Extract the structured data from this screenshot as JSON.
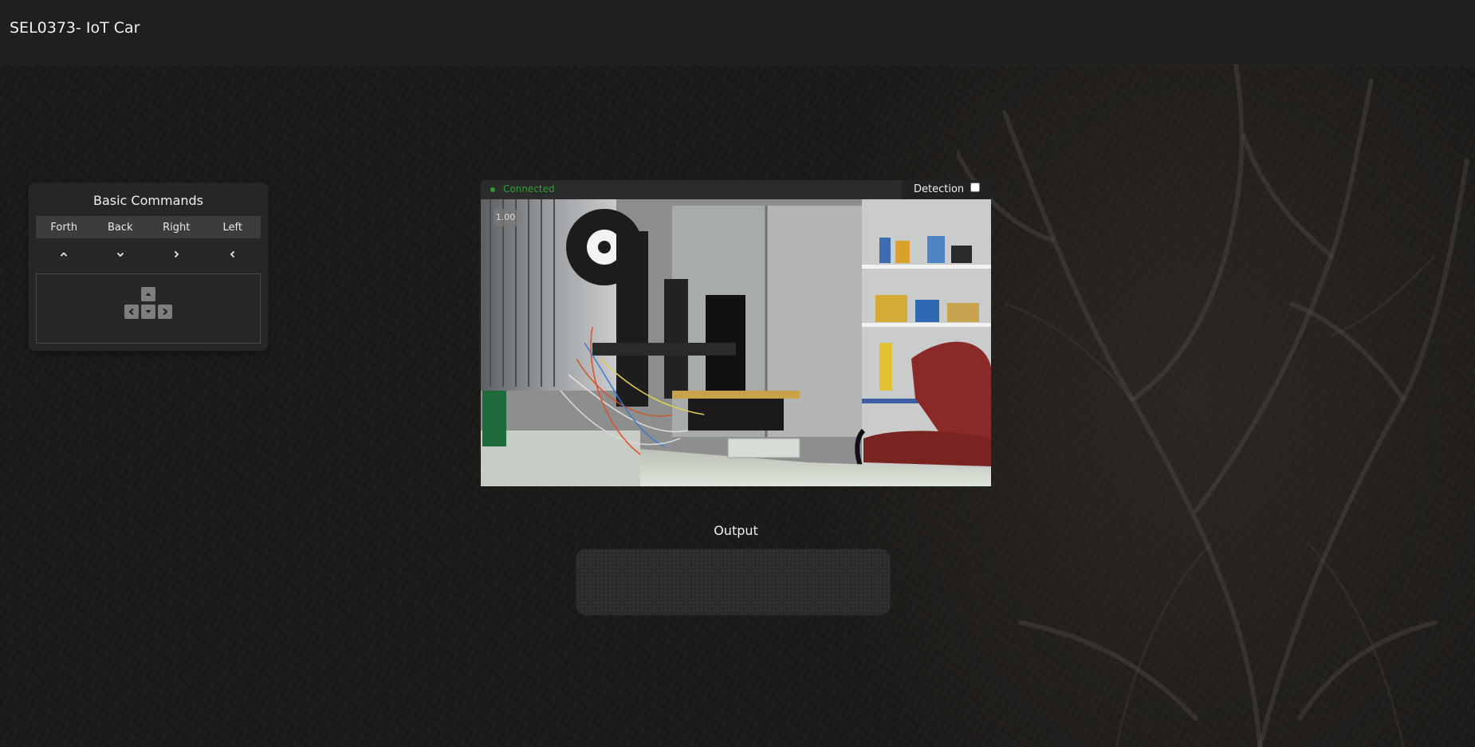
{
  "app": {
    "title": "SEL0373- IoT Car"
  },
  "commands": {
    "title": "Basic Commands",
    "columns": [
      "Forth",
      "Back",
      "Right",
      "Left"
    ],
    "column_icons": [
      "chevron-up-icon",
      "chevron-down-icon",
      "chevron-right-icon",
      "chevron-left-icon"
    ]
  },
  "video": {
    "status": "Connected",
    "detection_label": "Detection",
    "detection_checked": false,
    "fps": "1.00"
  },
  "output": {
    "label": "Output"
  },
  "colors": {
    "status_connected": "#2f9e2f",
    "topbar": "#1f1f1f",
    "panel": "#262626"
  }
}
